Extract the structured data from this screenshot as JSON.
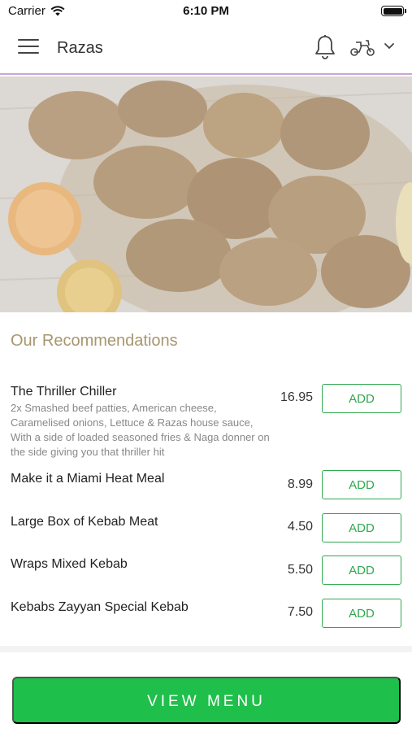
{
  "status_bar": {
    "carrier": "Carrier",
    "time": "6:10 PM"
  },
  "header": {
    "title": "Razas",
    "icons": [
      "menu-icon",
      "bell-icon",
      "scooter-icon",
      "chevron-down-icon"
    ],
    "accent_color": "#c7a6d8"
  },
  "recommendations": {
    "title": "Our Recommendations",
    "add_label": "ADD",
    "items": [
      {
        "name": "The Thriller Chiller",
        "description": "2x Smashed beef patties, American cheese, Caramelised onions, Lettuce & Razas house sauce, With a side of loaded seasoned fries & Naga donner on the side giving you that thriller hit",
        "price": "16.95"
      },
      {
        "name": "Make it a Miami Heat Meal",
        "price": "8.99"
      },
      {
        "name": "Large Box of Kebab Meat",
        "price": "4.50"
      },
      {
        "name": "Wraps Mixed Kebab",
        "price": "5.50"
      },
      {
        "name": "Kebabs Zayyan Special Kebab",
        "price": "7.50"
      }
    ]
  },
  "footer": {
    "view_menu_label": "VIEW MENU",
    "button_color": "#1fbf4b"
  },
  "colors": {
    "add_button": "#2fa84f",
    "section_title": "#a8966e"
  }
}
